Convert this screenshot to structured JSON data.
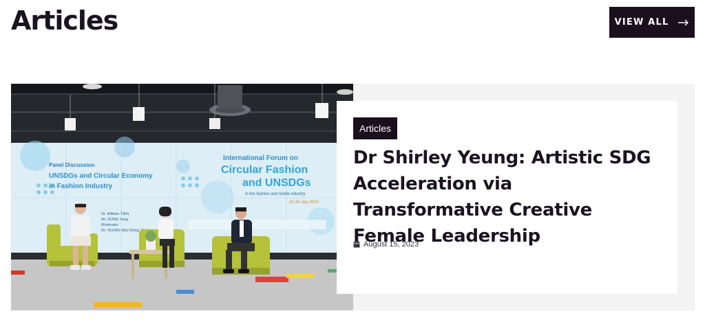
{
  "section": {
    "title": "Articles"
  },
  "view_all": {
    "label": "VIEW ALL",
    "icon": "arrow-right-icon"
  },
  "featured": {
    "category": "Articles",
    "title": "Dr Shirley Yeung: Artistic SDG Acceleration via Transformative Creative Female Leadership",
    "date": "August 15, 2023",
    "date_icon": "calendar-icon",
    "photo": {
      "screen_left": {
        "heading": "Panel Discussion",
        "title_line1": "UNSDGs and Circular Economy",
        "title_line2": "in Fashion Industry",
        "speaker1": "Dr. William TIEN",
        "speaker2": "Mr. SONG Yang",
        "moderator_label": "Moderator",
        "moderator": "Dr. YEUNG Wai Ching, Shirley"
      },
      "screen_right": {
        "heading": "International Forum on",
        "title_line1": "Circular Fashion",
        "title_line2": "and UNSDGs",
        "subtitle": "in the fashion and textile industry",
        "dates": "20-29 July 2023"
      }
    }
  },
  "colors": {
    "dark": "#1b0f1e",
    "card_bg": "#f3f3f3",
    "text": "#1a1320"
  }
}
